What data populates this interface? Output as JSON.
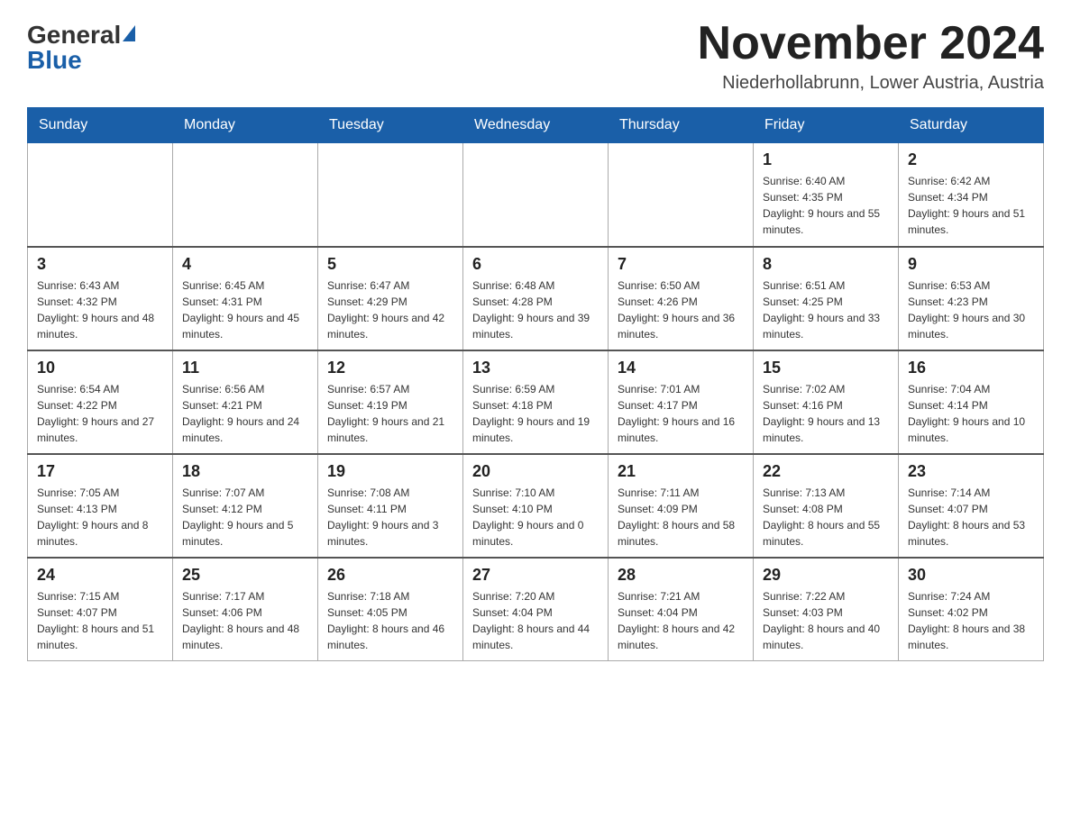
{
  "header": {
    "logo_general": "General",
    "logo_blue": "Blue",
    "month_title": "November 2024",
    "location": "Niederhollabrunn, Lower Austria, Austria"
  },
  "weekdays": [
    "Sunday",
    "Monday",
    "Tuesday",
    "Wednesday",
    "Thursday",
    "Friday",
    "Saturday"
  ],
  "weeks": [
    [
      {
        "day": "",
        "info": ""
      },
      {
        "day": "",
        "info": ""
      },
      {
        "day": "",
        "info": ""
      },
      {
        "day": "",
        "info": ""
      },
      {
        "day": "",
        "info": ""
      },
      {
        "day": "1",
        "info": "Sunrise: 6:40 AM\nSunset: 4:35 PM\nDaylight: 9 hours and 55 minutes."
      },
      {
        "day": "2",
        "info": "Sunrise: 6:42 AM\nSunset: 4:34 PM\nDaylight: 9 hours and 51 minutes."
      }
    ],
    [
      {
        "day": "3",
        "info": "Sunrise: 6:43 AM\nSunset: 4:32 PM\nDaylight: 9 hours and 48 minutes."
      },
      {
        "day": "4",
        "info": "Sunrise: 6:45 AM\nSunset: 4:31 PM\nDaylight: 9 hours and 45 minutes."
      },
      {
        "day": "5",
        "info": "Sunrise: 6:47 AM\nSunset: 4:29 PM\nDaylight: 9 hours and 42 minutes."
      },
      {
        "day": "6",
        "info": "Sunrise: 6:48 AM\nSunset: 4:28 PM\nDaylight: 9 hours and 39 minutes."
      },
      {
        "day": "7",
        "info": "Sunrise: 6:50 AM\nSunset: 4:26 PM\nDaylight: 9 hours and 36 minutes."
      },
      {
        "day": "8",
        "info": "Sunrise: 6:51 AM\nSunset: 4:25 PM\nDaylight: 9 hours and 33 minutes."
      },
      {
        "day": "9",
        "info": "Sunrise: 6:53 AM\nSunset: 4:23 PM\nDaylight: 9 hours and 30 minutes."
      }
    ],
    [
      {
        "day": "10",
        "info": "Sunrise: 6:54 AM\nSunset: 4:22 PM\nDaylight: 9 hours and 27 minutes."
      },
      {
        "day": "11",
        "info": "Sunrise: 6:56 AM\nSunset: 4:21 PM\nDaylight: 9 hours and 24 minutes."
      },
      {
        "day": "12",
        "info": "Sunrise: 6:57 AM\nSunset: 4:19 PM\nDaylight: 9 hours and 21 minutes."
      },
      {
        "day": "13",
        "info": "Sunrise: 6:59 AM\nSunset: 4:18 PM\nDaylight: 9 hours and 19 minutes."
      },
      {
        "day": "14",
        "info": "Sunrise: 7:01 AM\nSunset: 4:17 PM\nDaylight: 9 hours and 16 minutes."
      },
      {
        "day": "15",
        "info": "Sunrise: 7:02 AM\nSunset: 4:16 PM\nDaylight: 9 hours and 13 minutes."
      },
      {
        "day": "16",
        "info": "Sunrise: 7:04 AM\nSunset: 4:14 PM\nDaylight: 9 hours and 10 minutes."
      }
    ],
    [
      {
        "day": "17",
        "info": "Sunrise: 7:05 AM\nSunset: 4:13 PM\nDaylight: 9 hours and 8 minutes."
      },
      {
        "day": "18",
        "info": "Sunrise: 7:07 AM\nSunset: 4:12 PM\nDaylight: 9 hours and 5 minutes."
      },
      {
        "day": "19",
        "info": "Sunrise: 7:08 AM\nSunset: 4:11 PM\nDaylight: 9 hours and 3 minutes."
      },
      {
        "day": "20",
        "info": "Sunrise: 7:10 AM\nSunset: 4:10 PM\nDaylight: 9 hours and 0 minutes."
      },
      {
        "day": "21",
        "info": "Sunrise: 7:11 AM\nSunset: 4:09 PM\nDaylight: 8 hours and 58 minutes."
      },
      {
        "day": "22",
        "info": "Sunrise: 7:13 AM\nSunset: 4:08 PM\nDaylight: 8 hours and 55 minutes."
      },
      {
        "day": "23",
        "info": "Sunrise: 7:14 AM\nSunset: 4:07 PM\nDaylight: 8 hours and 53 minutes."
      }
    ],
    [
      {
        "day": "24",
        "info": "Sunrise: 7:15 AM\nSunset: 4:07 PM\nDaylight: 8 hours and 51 minutes."
      },
      {
        "day": "25",
        "info": "Sunrise: 7:17 AM\nSunset: 4:06 PM\nDaylight: 8 hours and 48 minutes."
      },
      {
        "day": "26",
        "info": "Sunrise: 7:18 AM\nSunset: 4:05 PM\nDaylight: 8 hours and 46 minutes."
      },
      {
        "day": "27",
        "info": "Sunrise: 7:20 AM\nSunset: 4:04 PM\nDaylight: 8 hours and 44 minutes."
      },
      {
        "day": "28",
        "info": "Sunrise: 7:21 AM\nSunset: 4:04 PM\nDaylight: 8 hours and 42 minutes."
      },
      {
        "day": "29",
        "info": "Sunrise: 7:22 AM\nSunset: 4:03 PM\nDaylight: 8 hours and 40 minutes."
      },
      {
        "day": "30",
        "info": "Sunrise: 7:24 AM\nSunset: 4:02 PM\nDaylight: 8 hours and 38 minutes."
      }
    ]
  ]
}
